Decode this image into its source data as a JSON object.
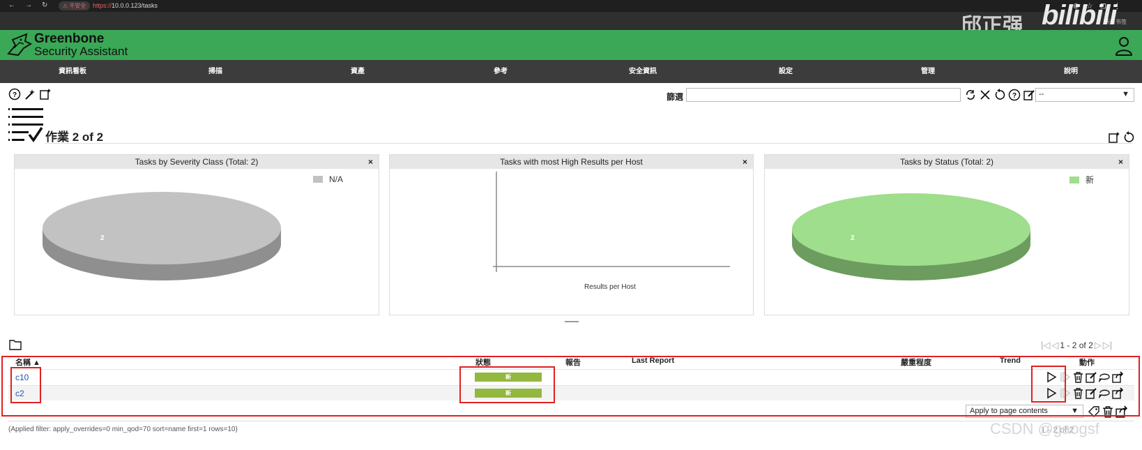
{
  "browser": {
    "security_label": "不安全",
    "url_scheme": "https://",
    "url_rest": "10.0.0.123/tasks",
    "bookmarks_label": "所有书签"
  },
  "watermarks": {
    "author": "邱正强",
    "site_logo": "bilibili",
    "csdn": "CSDN @gaogsf"
  },
  "app": {
    "title": "Greenbone",
    "subtitle": "Security Assistant",
    "brand_color": "#3aa856"
  },
  "menu": [
    "資訊看板",
    "掃描",
    "資產",
    "參考",
    "安全資訊",
    "設定",
    "管理",
    "說明"
  ],
  "filter": {
    "label": "篩選",
    "value": "",
    "select_value": "--"
  },
  "page": {
    "title": "作業 2 of 2"
  },
  "charts": [
    {
      "title": "Tasks by Severity Class (Total: 2)",
      "legend": "N/A",
      "slice_label": "2",
      "color": "#c2c2c2"
    },
    {
      "title": "Tasks with most High Results per Host",
      "xlabel": "Results per Host"
    },
    {
      "title": "Tasks by Status (Total: 2)",
      "legend": "新",
      "slice_label": "2",
      "color": "#9fde8c"
    }
  ],
  "chart_data": [
    {
      "type": "pie",
      "title": "Tasks by Severity Class (Total: 2)",
      "categories": [
        "N/A"
      ],
      "values": [
        2
      ],
      "legend_position": "top-right"
    },
    {
      "type": "bar",
      "title": "Tasks with most High Results per Host",
      "categories": [],
      "values": [],
      "xlabel": "Results per Host"
    },
    {
      "type": "pie",
      "title": "Tasks by Status (Total: 2)",
      "categories": [
        "新"
      ],
      "values": [
        2
      ],
      "legend_position": "top-right"
    }
  ],
  "table": {
    "pager_top": "1 - 2 of 2",
    "headers": {
      "name": "名稱 ▲",
      "status": "狀態",
      "report": "報告",
      "last_report": "Last Report",
      "severity": "嚴重程度",
      "trend": "Trend",
      "actions": "動作"
    },
    "rows": [
      {
        "name": "c10",
        "status": "新"
      },
      {
        "name": "c2",
        "status": "新"
      }
    ],
    "bulk_select": "Apply to page contents",
    "applied_filter": "(Applied filter: apply_overrides=0 min_qod=70 sort=name first=1 rows=10)",
    "pager_bottom": "1 - 2 of 2"
  }
}
